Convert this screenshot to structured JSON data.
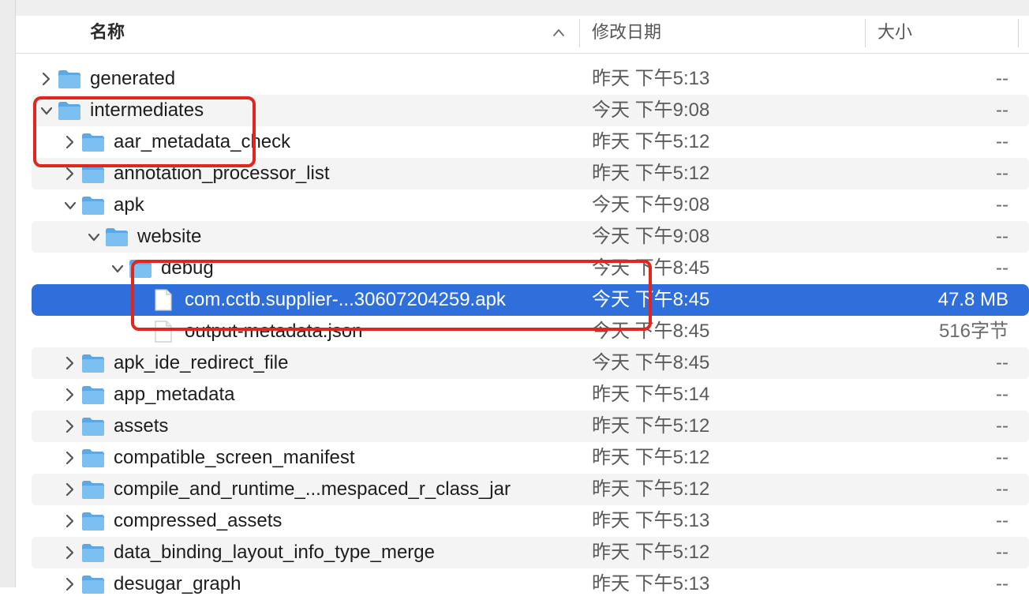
{
  "header": {
    "name_label": "名称",
    "date_label": "修改日期",
    "size_label": "大小"
  },
  "rows": [
    {
      "name": "generated",
      "date": "昨天 下午5:13",
      "size": "--",
      "expanded": false
    },
    {
      "name": "intermediates",
      "date": "今天 下午9:08",
      "size": "--",
      "expanded": true
    },
    {
      "name": "aar_metadata_check",
      "date": "昨天 下午5:12",
      "size": "--",
      "expanded": false
    },
    {
      "name": "annotation_processor_list",
      "date": "昨天 下午5:12",
      "size": "--",
      "expanded": false
    },
    {
      "name": "apk",
      "date": "今天 下午9:08",
      "size": "--",
      "expanded": true
    },
    {
      "name": "website",
      "date": "今天 下午9:08",
      "size": "--",
      "expanded": true
    },
    {
      "name": "debug",
      "date": "今天 下午8:45",
      "size": "--",
      "expanded": true
    },
    {
      "name": "com.cctb.supplier-...30607204259.apk",
      "date": "今天 下午8:45",
      "size": "47.8 MB",
      "selected": true
    },
    {
      "name": "output-metadata.json",
      "date": "今天 下午8:45",
      "size": "516字节"
    },
    {
      "name": "apk_ide_redirect_file",
      "date": "今天 下午8:45",
      "size": "--",
      "expanded": false
    },
    {
      "name": "app_metadata",
      "date": "昨天 下午5:14",
      "size": "--",
      "expanded": false
    },
    {
      "name": "assets",
      "date": "昨天 下午5:12",
      "size": "--",
      "expanded": false
    },
    {
      "name": "compatible_screen_manifest",
      "date": "昨天 下午5:12",
      "size": "--",
      "expanded": false
    },
    {
      "name": "compile_and_runtime_...mespaced_r_class_jar",
      "date": "昨天 下午5:12",
      "size": "--",
      "expanded": false
    },
    {
      "name": "compressed_assets",
      "date": "昨天 下午5:13",
      "size": "--",
      "expanded": false
    },
    {
      "name": "data_binding_layout_info_type_merge",
      "date": "昨天 下午5:12",
      "size": "--",
      "expanded": false
    },
    {
      "name": "desugar_graph",
      "date": "昨天 下午5:13",
      "size": "--",
      "expanded": false
    }
  ],
  "colors": {
    "selection": "#2f6fdc",
    "annotation_box": "#e0261e",
    "folder": "#5aa9e6"
  }
}
